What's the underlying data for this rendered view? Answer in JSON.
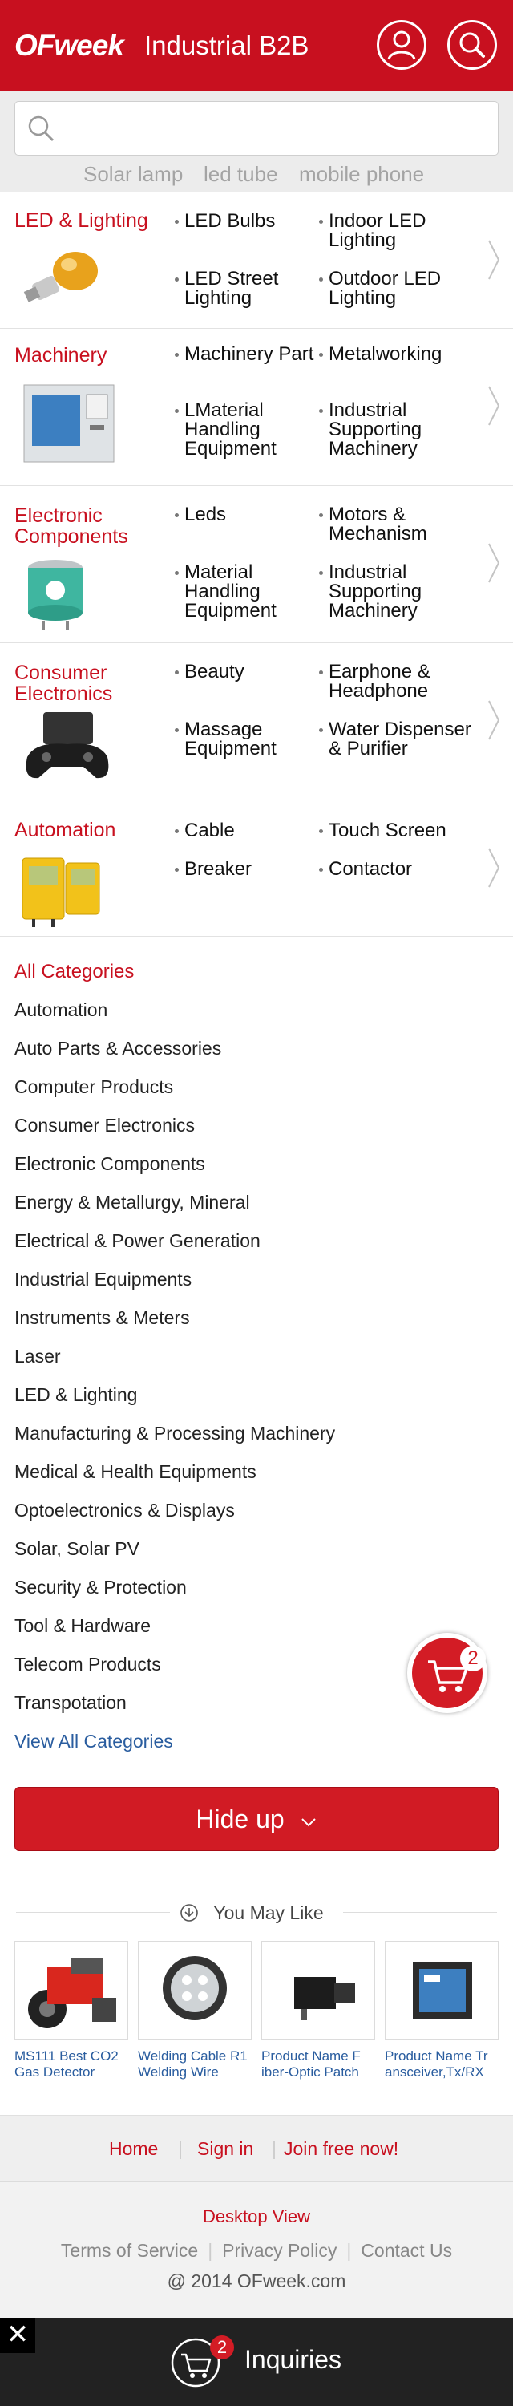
{
  "header": {
    "logo": "OFweek",
    "title": "Industrial B2B"
  },
  "search": {
    "placeholder": "",
    "hot_keywords": [
      "Solar lamp",
      "led tube",
      "mobile phone"
    ]
  },
  "categories": [
    {
      "title": "LED & Lighting",
      "subs": [
        "LED Bulbs",
        "Indoor LED Lighting",
        "LED Street Lighting",
        "Outdoor LED Lighting"
      ]
    },
    {
      "title": "Machinery",
      "subs": [
        "Machinery Part",
        "Metalworking",
        "LMaterial Handling Equipment",
        "Industrial Supporting Machinery"
      ]
    },
    {
      "title": "Electronic Components",
      "subs": [
        "Leds",
        "Motors & Mechanism",
        "Material Handling Equipment",
        "Industrial Supporting Machinery"
      ]
    },
    {
      "title": "Consumer Electronics",
      "subs": [
        "Beauty",
        "Earphone & Headphone",
        "Massage Equipment",
        "Water Dispenser & Purifier"
      ]
    },
    {
      "title": "Automation",
      "subs": [
        "Cable",
        "Touch Screen",
        "Breaker",
        "Contactor"
      ]
    }
  ],
  "all_categories": {
    "heading": "All Categories",
    "items": [
      "Automation",
      "Auto Parts & Accessories",
      "Computer Products",
      "Consumer Electronics",
      "Electronic Components",
      "Energy & Metallurgy, Mineral",
      "Electrical & Power Generation",
      "Industrial Equipments",
      "Instruments & Meters",
      "Laser",
      "LED & Lighting",
      "Manufacturing & Processing Machinery",
      "Medical & Health Equipments",
      "Optoelectronics & Displays",
      "Solar, Solar PV",
      "Security & Protection",
      "Tool & Hardware",
      "Telecom Products",
      "Transpotation"
    ],
    "view_all": "View All Categories"
  },
  "hide_button": "Hide up",
  "cart": {
    "count": "2"
  },
  "you_may_like": {
    "title": "You May Like",
    "products": [
      {
        "name": "MS111 Best CO2 Gas Detector"
      },
      {
        "name": "Welding Cable R1 Welding Wire"
      },
      {
        "name": "Product Name F iber-Optic Patch"
      },
      {
        "name": "Product Name Tr ansceiver,Tx/RX"
      }
    ]
  },
  "footer": {
    "home": "Home",
    "sign_in": "Sign in",
    "join": "Join free now!",
    "desktop_view": "Desktop View",
    "terms": "Terms of Service",
    "privacy": "Privacy Policy",
    "contact": "Contact Us",
    "copyright": "@ 2014 OFweek.com"
  },
  "inquiries": {
    "label": "Inquiries",
    "count": "2",
    "close": "✕"
  },
  "colors": {
    "brand_red": "#c8101f",
    "link_blue": "#2a5d9f"
  }
}
